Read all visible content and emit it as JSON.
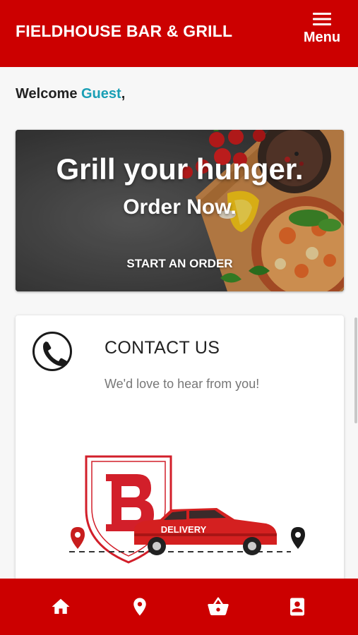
{
  "header": {
    "brand": "FIELDHOUSE BAR & GRILL",
    "menu_label": "Menu",
    "menu_icon": "hamburger-icon"
  },
  "welcome": {
    "prefix": "Welcome ",
    "user": "Guest",
    "suffix": ","
  },
  "hero": {
    "title": "Grill your hunger.",
    "subtitle": "Order Now.",
    "cta": "START AN ORDER"
  },
  "contact": {
    "title": "CONTACT US",
    "subtitle": "We'd love to hear from you!",
    "icon": "phone-icon"
  },
  "delivery_graphic": {
    "logo_letter": "B",
    "car_label": "DELIVERY"
  },
  "bottom_nav": {
    "items": [
      {
        "icon": "home-icon"
      },
      {
        "icon": "location-pin-icon"
      },
      {
        "icon": "basket-icon"
      },
      {
        "icon": "account-icon"
      }
    ]
  },
  "colors": {
    "brand_red": "#cc0000",
    "accent_teal": "#1a9fb5"
  }
}
